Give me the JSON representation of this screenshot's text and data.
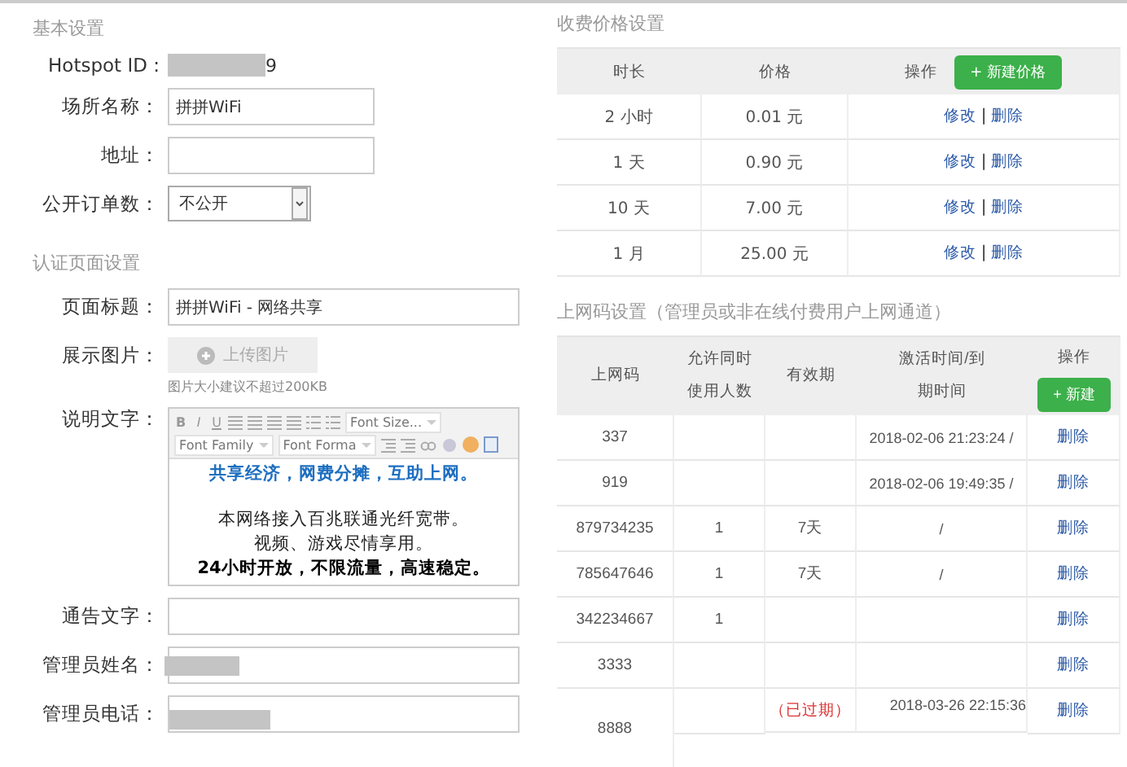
{
  "basic_settings": {
    "title": "基本设置",
    "hotspot_id": {
      "label": "Hotspot ID :",
      "value": "9",
      "redacted": true
    },
    "fields": [
      {
        "label": "场所名称：",
        "value": "拼拼WiFi"
      },
      {
        "label": "地址："
      }
    ],
    "order_count": {
      "label": "公开订单数：",
      "value": "不公开"
    }
  },
  "auth_page": {
    "title": "认证页面设置",
    "page_title": {
      "label": "页面标题：",
      "value": "拼拼WiFi - 网络共享"
    },
    "image": {
      "label": "展示图片：",
      "button": "上传图片",
      "hint": "图片大小建议不超过200KB"
    },
    "description": {
      "label": "说明文字：",
      "format_buttons": [
        "B",
        "I",
        "U"
      ],
      "selects": [
        "Font Size...",
        "Font Family",
        "Font Forma"
      ],
      "lines": [
        {
          "kind": "highlight",
          "text": "共享经济，网费分摊，互助上网。"
        },
        {
          "kind": "blank"
        },
        {
          "kind": "normal",
          "text": "本网络接入百兆联通光纤宽带。"
        },
        {
          "kind": "normal",
          "text": "视频、游戏尽情享用。"
        },
        {
          "kind": "strong",
          "text": "24小时开放，不限流量，高速稳定。"
        }
      ]
    },
    "fields": [
      {
        "label": "通告文字：",
        "redacted": false
      },
      {
        "label": "管理员姓名：",
        "redacted": true
      },
      {
        "label": "管理员电话：",
        "redacted": true
      }
    ]
  },
  "price_settings": {
    "title": "收费价格设置",
    "columns": [
      "时长",
      "价格",
      "操作"
    ],
    "new_button": "+ 新建价格",
    "rows": [
      {
        "duration": "2 小时",
        "price": "0.01 元",
        "edit": "修改",
        "sep": "|",
        "delete": "删除"
      },
      {
        "duration": "1 天",
        "price": "0.90 元",
        "edit": "修改",
        "sep": "|",
        "delete": "删除"
      },
      {
        "duration": "10 天",
        "price": "7.00 元",
        "edit": "修改",
        "sep": "|",
        "delete": "删除"
      },
      {
        "duration": "1 月",
        "price": "25.00 元",
        "edit": "修改",
        "sep": "|",
        "delete": "删除"
      }
    ]
  },
  "code_settings": {
    "title": "上网码设置（管理员或非在线付费用户上网通道）",
    "columns": [
      "上网码",
      "允许同时使用人数",
      "有效期",
      "激活时间/到期时间",
      "操作"
    ],
    "new_button": "+ 新建",
    "rows": [
      {
        "code": "337",
        "activated": "2018-02-06 21:23:24 /",
        "action": "删除"
      },
      {
        "code": "919",
        "activated": "2018-02-06 19:49:35 /",
        "action": "删除"
      },
      {
        "code": "879734235",
        "users": "1",
        "validity": "7天",
        "activated": "/",
        "action": "删除"
      },
      {
        "code": "785647646",
        "users": "1",
        "validity": "7天",
        "activated": "/",
        "action": "删除"
      },
      {
        "code": "342234667",
        "users": "1",
        "action": "删除"
      },
      {
        "code": "3333",
        "action": "删除"
      },
      {
        "code": "8888",
        "validity": "（已过期）",
        "expired": true,
        "expires": "2018-03-26 22:15:36",
        "action": "删除"
      }
    ]
  }
}
